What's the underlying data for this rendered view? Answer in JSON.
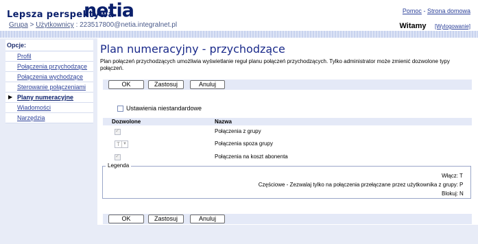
{
  "header": {
    "tagline": "Lepsza perspektywa",
    "logo": "netia",
    "help_link": "Pomoc",
    "separator": "-",
    "home_link": "Strona domowa",
    "breadcrumb": {
      "group_link": "Grupa",
      "sep1": ">",
      "users_link": "Użytkownicy",
      "sep2": ":",
      "user": "223517800@netia.integralnet.pl"
    },
    "welcome": "Witamy",
    "logout_link": "[Wylogowanie]"
  },
  "sidebar": {
    "label": "Opcje:",
    "items": [
      {
        "label": "Profil"
      },
      {
        "label": "Połączenia przychodzące"
      },
      {
        "label": "Połączenia wychodzące"
      },
      {
        "label": "Sterowanie połączeniami"
      },
      {
        "label": "Plany numeracyjne"
      },
      {
        "label": "Wiadomości"
      },
      {
        "label": "Narzędzia"
      }
    ],
    "active_index": 4
  },
  "main": {
    "title": "Plan numeracyjny - przychodzące",
    "description": "Plan połączeń przychodzących umożliwia wyświetlanie reguł planu połączeń przychodzących. Tylko administrator może zmienić dozwolone typy połączeń.",
    "buttons": {
      "ok": "OK",
      "apply": "Zastosuj",
      "cancel": "Anuluj"
    },
    "custom_settings_label": "Ustawienia niestandardowe",
    "custom_settings_checked": false,
    "table": {
      "col_allowed": "Dozwolone",
      "col_name": "Nazwa",
      "rows": [
        {
          "name": "Połączenia z grupy",
          "control": "checkbox",
          "checked": true
        },
        {
          "name": "Połączenia spoza grupy",
          "control": "select",
          "value": "T"
        },
        {
          "name": "Połączenia na koszt abonenta",
          "control": "checkbox",
          "checked": true
        }
      ]
    },
    "legend": {
      "title": "Legenda",
      "entries": [
        {
          "label": "Włącz:",
          "code": "T"
        },
        {
          "label": "Częściowe - Zezwalaj tylko na połączenia przełączane przez użytkownika z grupy:",
          "code": "P"
        },
        {
          "label": "Blokuj:",
          "code": "N"
        }
      ]
    }
  },
  "colors": {
    "brand": "#0a1f6b",
    "link": "#2a3f99",
    "panel_bg": "#e8ecf7",
    "toolbar_bg": "#e4e9f7"
  }
}
